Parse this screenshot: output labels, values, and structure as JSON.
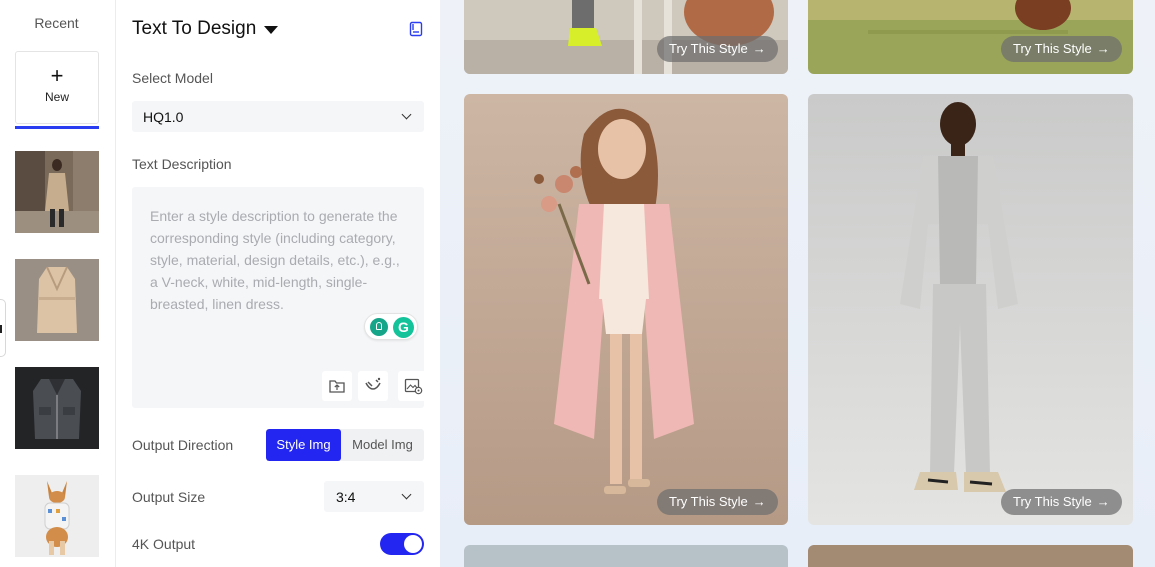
{
  "recent": {
    "title": "Recent",
    "new_label": "New",
    "items": [
      {
        "name": "recent-woman-trench"
      },
      {
        "name": "recent-beige-coat"
      },
      {
        "name": "recent-leather-jacket"
      },
      {
        "name": "recent-dog-sweater"
      }
    ]
  },
  "panel": {
    "title": "Text To Design",
    "select_model_label": "Select Model",
    "model_value": "HQ1.0",
    "text_description_label": "Text Description",
    "description_placeholder": "Enter a style description to generate the corresponding style (including category, style, material, design details, etc.), e.g., a V-neck, white, mid-length, single-breasted, linen dress.",
    "output_direction_label": "Output Direction",
    "direction_options": [
      "Style Img",
      "Model Img"
    ],
    "direction_selected": "Style Img",
    "output_size_label": "Output Size",
    "output_size_value": "3:4",
    "output_4k_label": "4K Output",
    "output_4k_enabled": true
  },
  "gallery": {
    "try_label": "Try This Style",
    "arrow": "→"
  },
  "colors": {
    "accent": "#2326f0",
    "underline": "#2b3df0",
    "gallery_bg": "#eef2f8"
  }
}
